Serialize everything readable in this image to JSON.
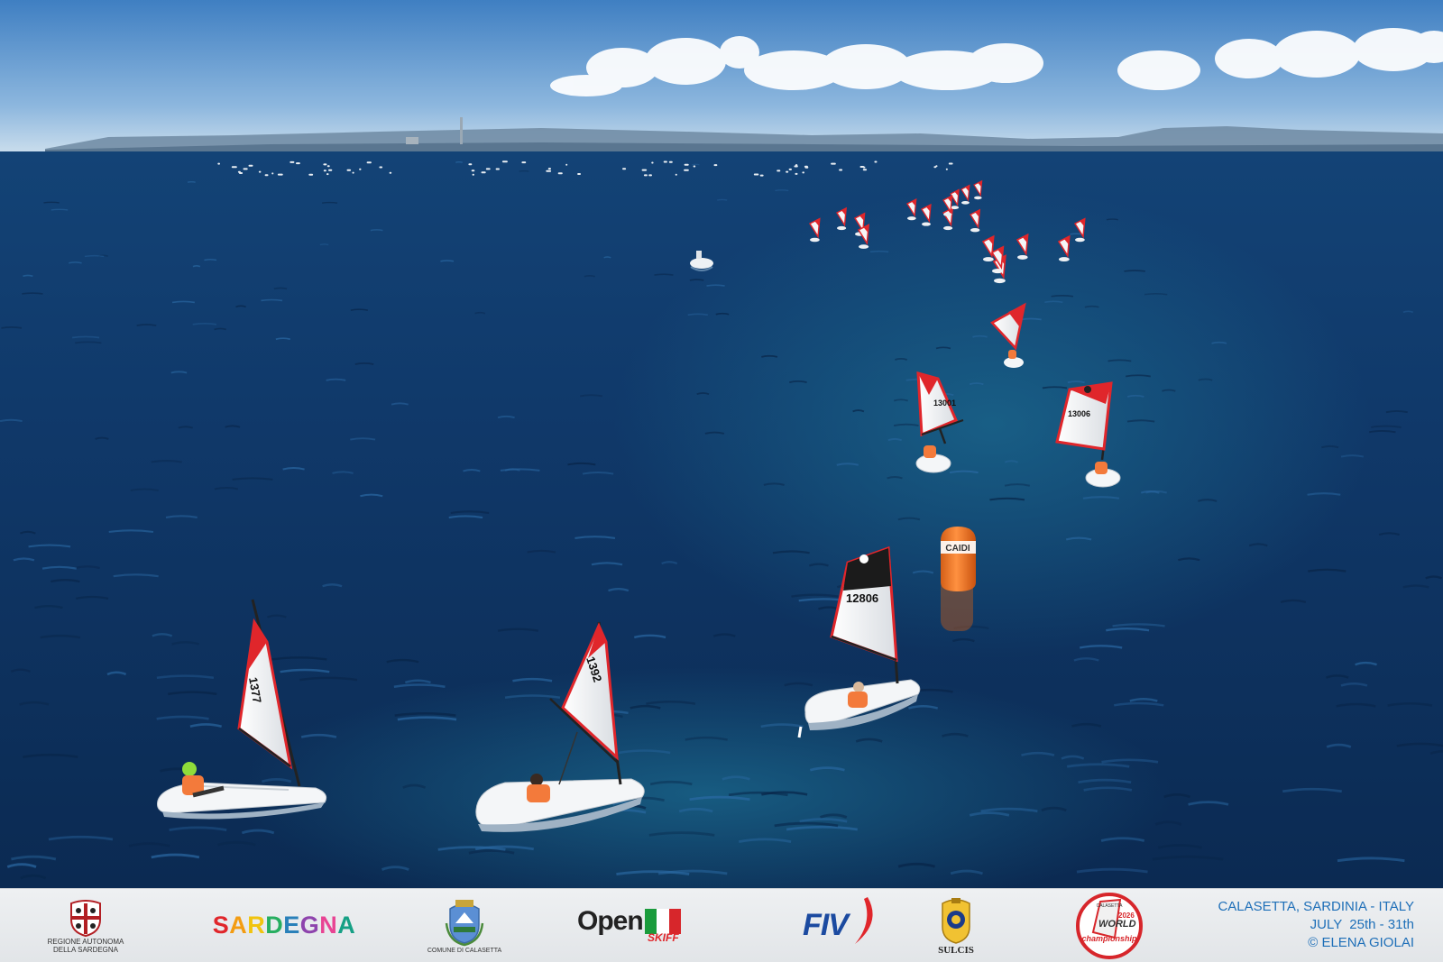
{
  "photo": {
    "sail_numbers": [
      "1377",
      "1392",
      "12806",
      "13001",
      "13006"
    ],
    "buoy_text": "CAIDI"
  },
  "footer": {
    "sponsors": {
      "sardegna_region": {
        "line1": "REGIONE AUTONOMA",
        "line2": "DELLA SARDEGNA"
      },
      "sardegna_brand": "SARDEGNA",
      "calasetta": "COMUNE DI CALASETTA",
      "open_skiff": {
        "open": "Open",
        "skiff": "SKIFF"
      },
      "fiv": "FIV",
      "sulcis": "SULCIS",
      "worlds_badge": {
        "top": "CALASETTA",
        "middle": "WORLD",
        "year": "2026",
        "bottom": "championship"
      }
    },
    "event": {
      "location": "CALASETTA, SARDINIA - ITALY",
      "dates": "JULY  25th - 31th",
      "credit": "© ELENA GIOLAI"
    }
  },
  "colors": {
    "sea_deep": "#0d2f5c",
    "sea_mid": "#164c86",
    "sky_top": "#3f7fc2",
    "sail_red": "#e0262b",
    "footer_text": "#1e6fb8",
    "buoy": "#f07a2a"
  }
}
